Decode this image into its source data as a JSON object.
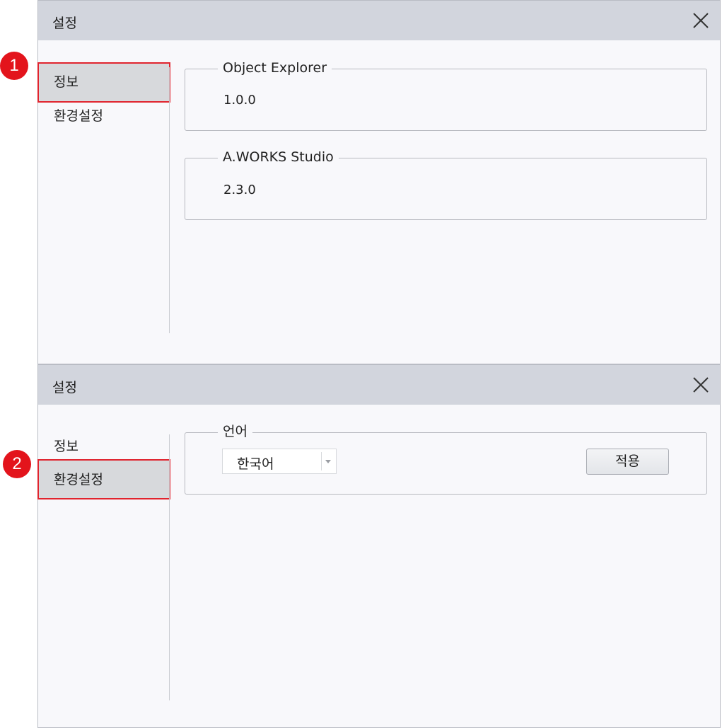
{
  "dialogs": [
    {
      "title": "설정",
      "badge": "1",
      "nav": [
        {
          "label": "정보",
          "selected": true
        },
        {
          "label": "환경설정",
          "selected": false
        }
      ],
      "groups": [
        {
          "legend": "Object Explorer",
          "value": "1.0.0"
        },
        {
          "legend": "A.WORKS Studio",
          "value": "2.3.0"
        }
      ]
    },
    {
      "title": "설정",
      "badge": "2",
      "nav": [
        {
          "label": "정보",
          "selected": false
        },
        {
          "label": "환경설정",
          "selected": true
        }
      ],
      "language": {
        "legend": "언어",
        "selected_value": "한국어",
        "apply_label": "적용"
      }
    }
  ],
  "icons": {
    "close": "close-icon",
    "dropdown": "chevron-down-icon"
  },
  "colors": {
    "titlebar": "#d2d5dd",
    "panel": "#f8f8fb",
    "selected_nav": "#d7d9dc",
    "highlight": "#e0242e",
    "badge": "#e3141c"
  }
}
